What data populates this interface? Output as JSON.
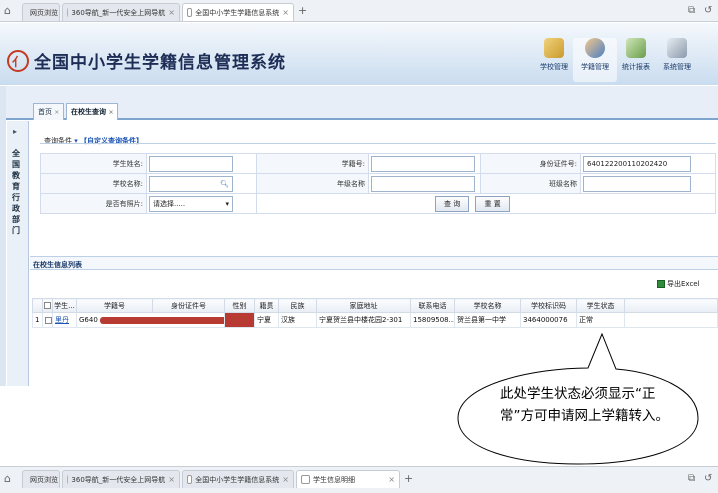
{
  "browser": {
    "tabs": [
      {
        "label": "网页浏览",
        "color": "#2fa33a"
      },
      {
        "label": "360导航_新一代安全上网导航",
        "color": "#e9b31a"
      },
      {
        "label": "全国中小学生学籍信息系统",
        "color": "#ffffff"
      }
    ],
    "bottom_tabs": [
      {
        "label": "网页浏览",
        "color": "#2fa33a"
      },
      {
        "label": "360导航_新一代安全上网导航",
        "color": "#e9b31a"
      },
      {
        "label": "全国中小学生学籍信息系统",
        "color": "#ffffff"
      },
      {
        "label": "学生信息明细",
        "color": "#ffffff"
      }
    ],
    "new_tab": "+",
    "close": "×"
  },
  "app": {
    "title": "全国中小学生学籍信息管理系统",
    "logo_char": "亻"
  },
  "topnav": [
    {
      "label": "学校管理",
      "icon": "building-icon",
      "color": "#c99a2e"
    },
    {
      "label": "学籍管理",
      "icon": "student-icon",
      "color": "#4b7fc4"
    },
    {
      "label": "统计报表",
      "icon": "chart-icon",
      "color": "#6a9d4a"
    },
    {
      "label": "系统管理",
      "icon": "gear-icon",
      "color": "#8a9aab"
    }
  ],
  "page_tabs": [
    {
      "label": "首页"
    },
    {
      "label": "在校生查询"
    }
  ],
  "sidebar": {
    "label": "全国教育行政部门"
  },
  "query": {
    "legend": "查询条件",
    "custom_link": "【自定义查询条件】",
    "student_name_label": "学生姓名:",
    "student_name_value": "",
    "student_no_label": "学籍号:",
    "student_no_value": "",
    "id_label": "身份证件号:",
    "id_value": "640122200110202420",
    "school_label": "学校名称:",
    "school_value": "",
    "grade_label": "年级名称",
    "grade_value": "",
    "class_label": "班级名称",
    "class_value": "",
    "photo_label": "是否有照片:",
    "photo_value": "请选择.....",
    "query_button": "查 询",
    "reset_button": "重 置"
  },
  "list": {
    "title": "在校生信息列表",
    "export_label": "导出Excel",
    "columns": [
      "学生...",
      "学籍号",
      "身份证件号",
      "性别",
      "籍贯",
      "民族",
      "家庭地址",
      "联系电话",
      "学校名称",
      "学校标识码",
      "学生状态"
    ],
    "rows": [
      {
        "index": "1",
        "name": "里丹",
        "student_no": "G640",
        "id_no": "",
        "gender": "",
        "native_place": "宁夏",
        "ethnicity": "汉族",
        "address": "宁夏贺兰县中楼花园2-301",
        "phone": "15809508...",
        "school": "贺兰县第一中学",
        "school_code": "3464000076",
        "status": "正常"
      }
    ]
  },
  "callout": {
    "text": "此处学生状态必须显示“正常”方可申请网上学籍转入。"
  }
}
